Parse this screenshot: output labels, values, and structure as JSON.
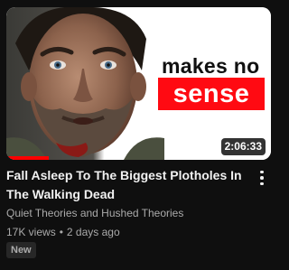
{
  "video": {
    "thumbnail": {
      "overlay_text_top": "makes no",
      "overlay_text_highlight": "sense",
      "highlight_color": "#ff0a12",
      "duration": "2:06:33",
      "watch_progress": 0.16
    },
    "title": "Fall Asleep To The Biggest Plotholes In The Walking Dead",
    "channel": "Quiet Theories and Hushed Theories",
    "views": "17K views",
    "separator": "•",
    "published": "2 days ago",
    "badge": "New",
    "menu_icon": "more-vertical-icon"
  }
}
